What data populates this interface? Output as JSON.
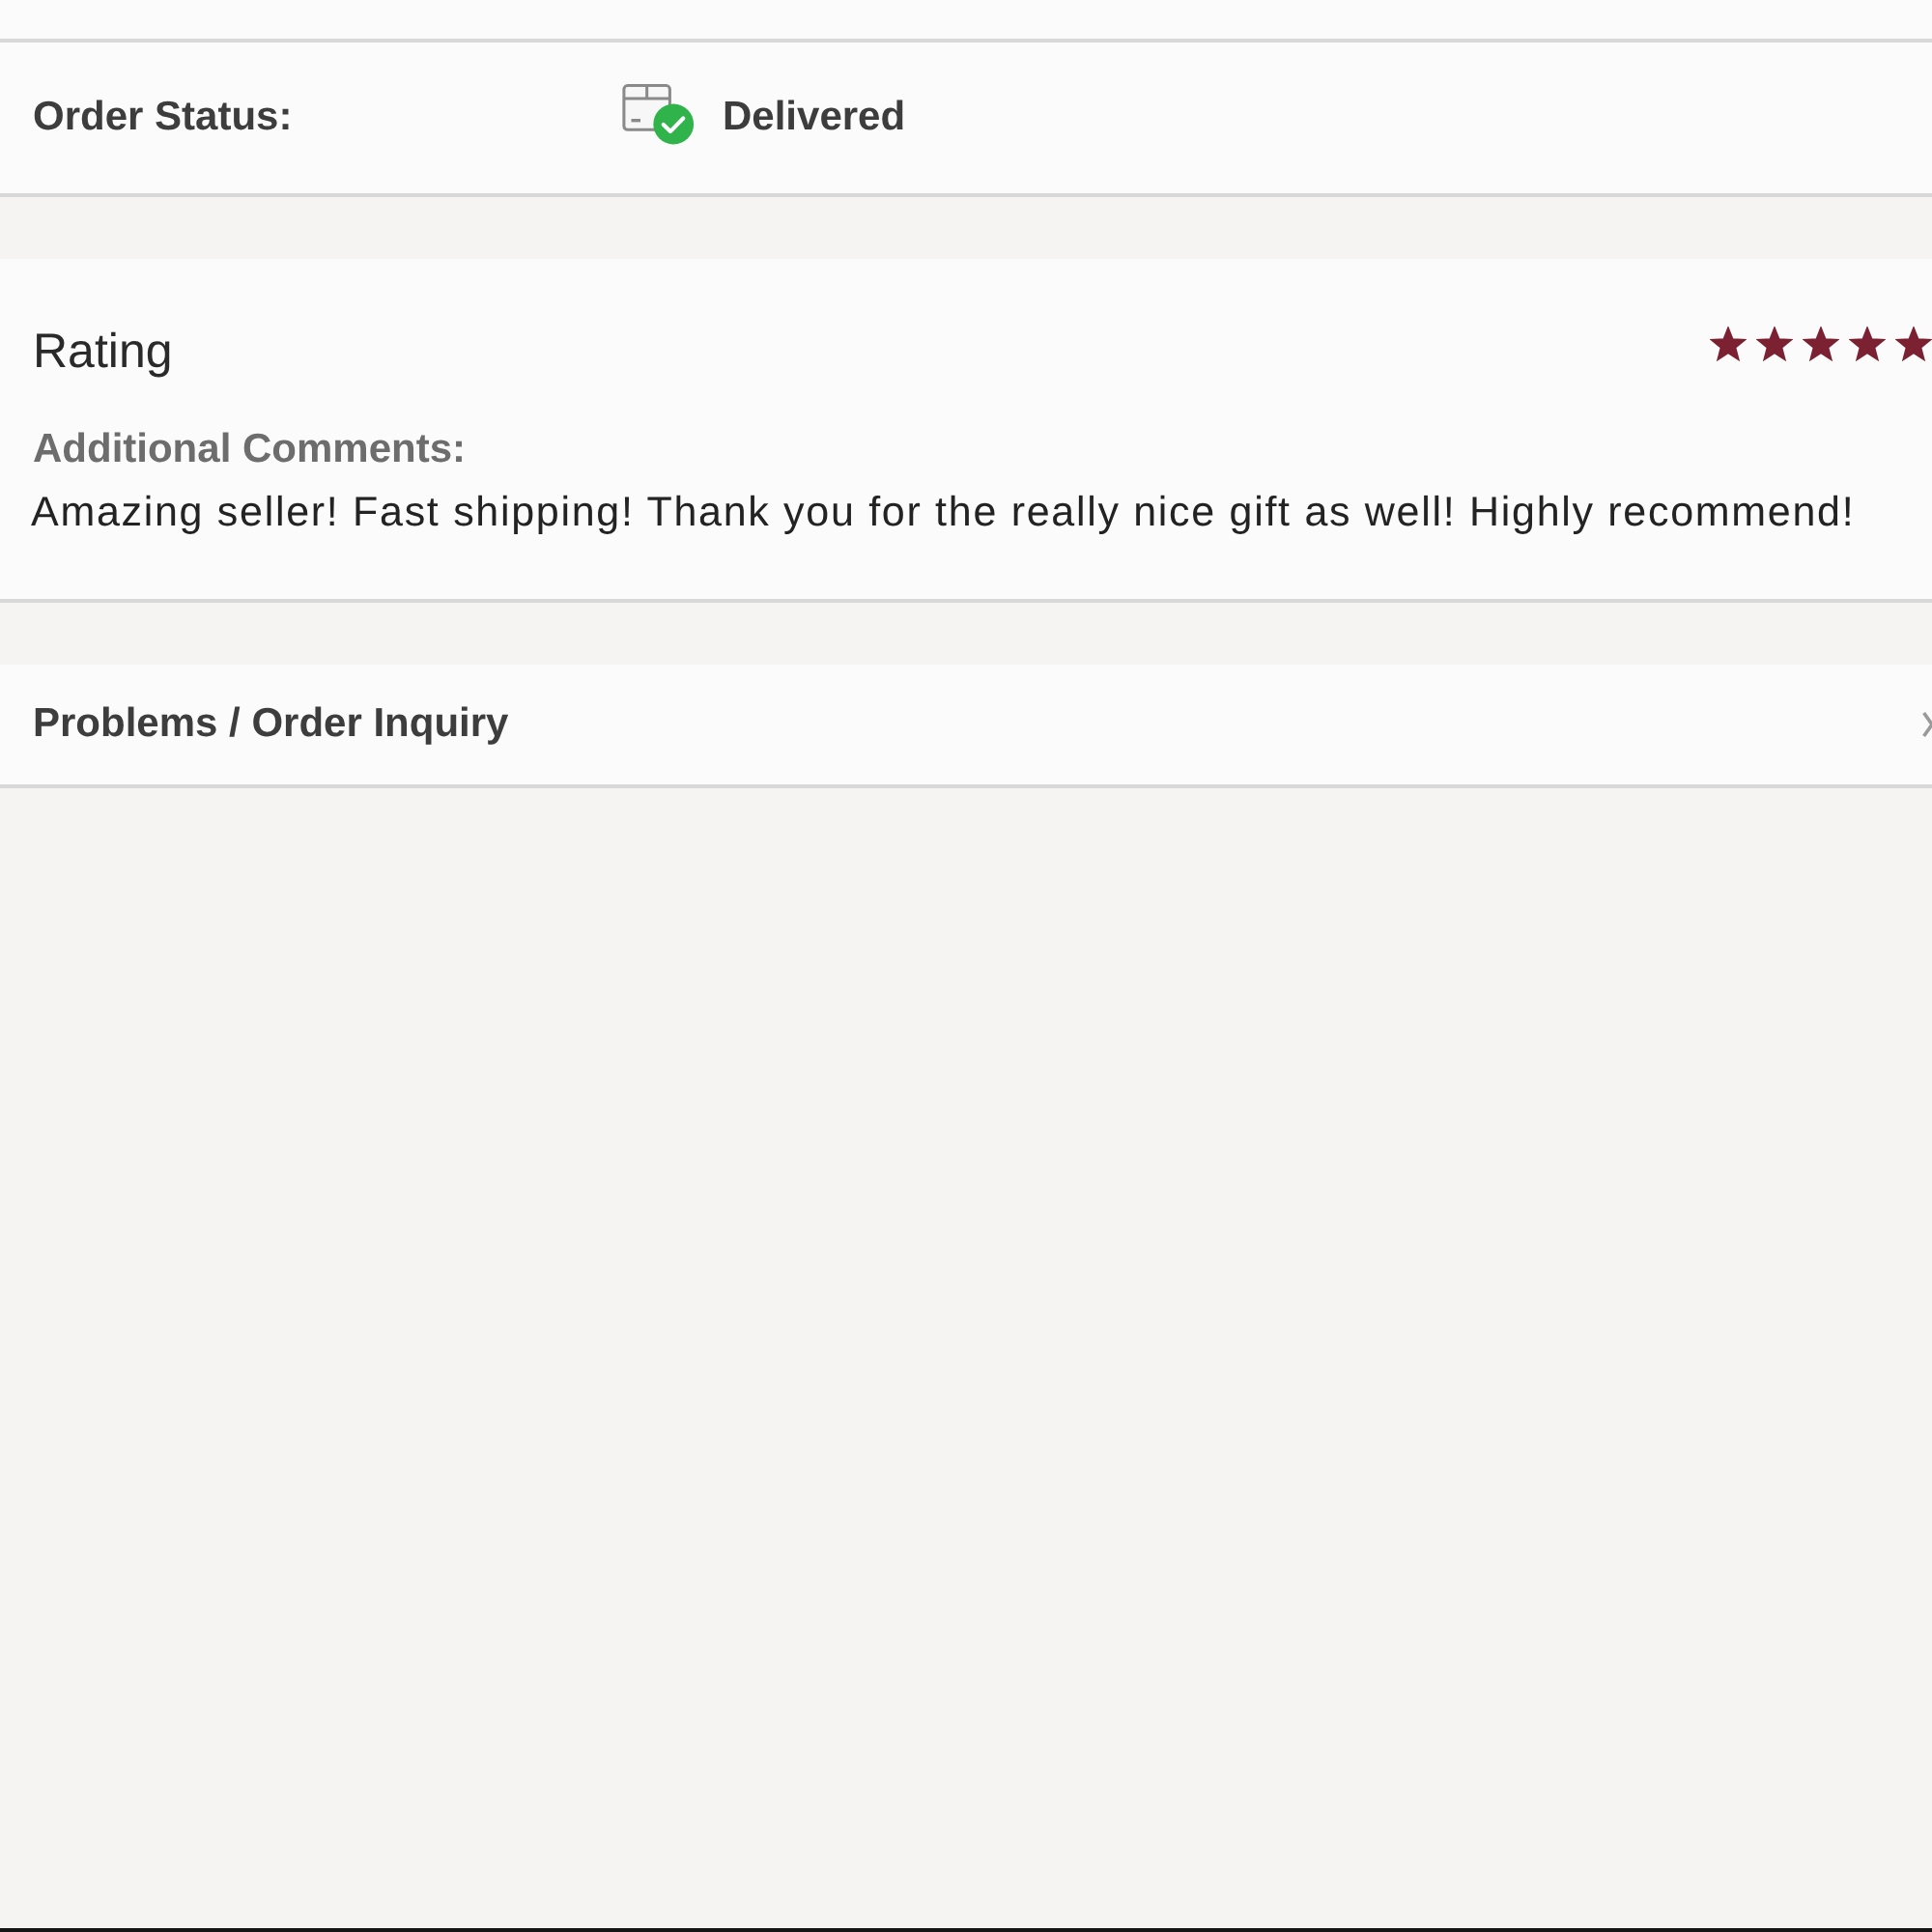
{
  "order_status": {
    "label": "Order Status:",
    "value": "Delivered"
  },
  "rating": {
    "title": "Rating",
    "stars": 5,
    "comments_label": "Additional Comments:",
    "comments": "Amazing seller! Fast shipping! Thank you for the really nice gift as well! Highly recommend!"
  },
  "problems": {
    "label": "Problems / Order Inquiry"
  }
}
